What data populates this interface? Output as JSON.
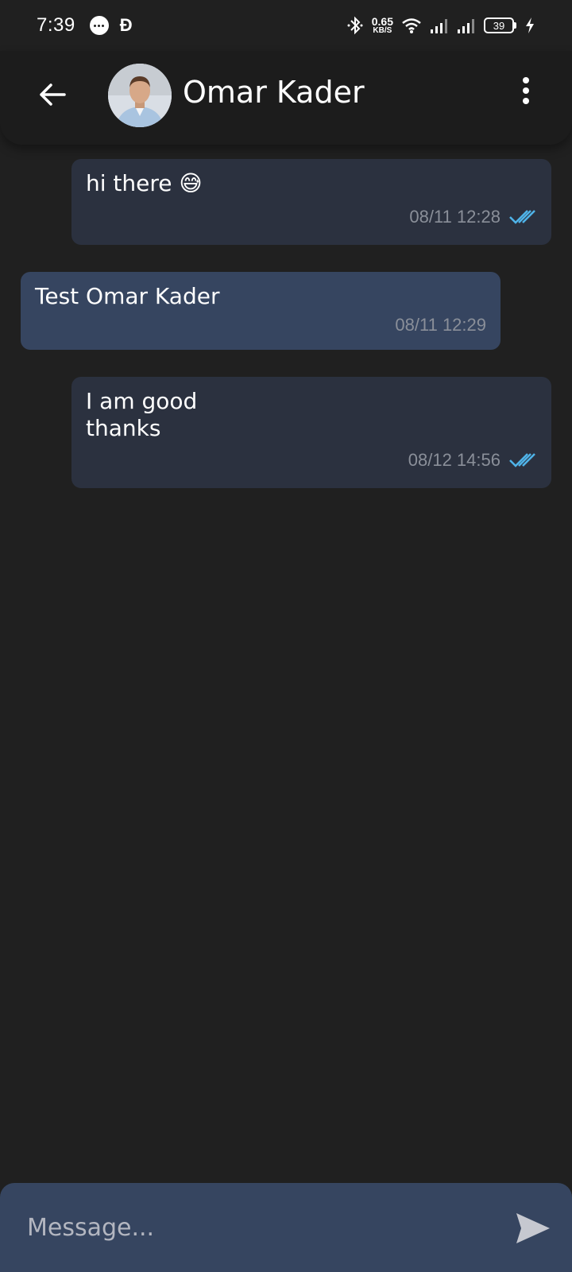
{
  "status_bar": {
    "time": "7:39",
    "notif_letter": "Ð",
    "network_speed_value": "0.65",
    "network_speed_unit": "KB/S",
    "battery": "39"
  },
  "header": {
    "contact_name": "Omar Kader"
  },
  "messages": [
    {
      "direction": "sent",
      "text": "hi there 😅",
      "time": "08/11 12:28",
      "read": true
    },
    {
      "direction": "received",
      "text": "Test Omar Kader",
      "time": "08/11 12:29"
    },
    {
      "direction": "sent",
      "text": "I am good\nthanks",
      "time": "08/12 14:56",
      "read": true
    }
  ],
  "composer": {
    "placeholder": "Message..."
  },
  "colors": {
    "background": "#202020",
    "sent_bubble": "#2b313f",
    "received_bubble": "#364560",
    "read_tick": "#4fb3e8",
    "timestamp": "#8a8f99"
  }
}
